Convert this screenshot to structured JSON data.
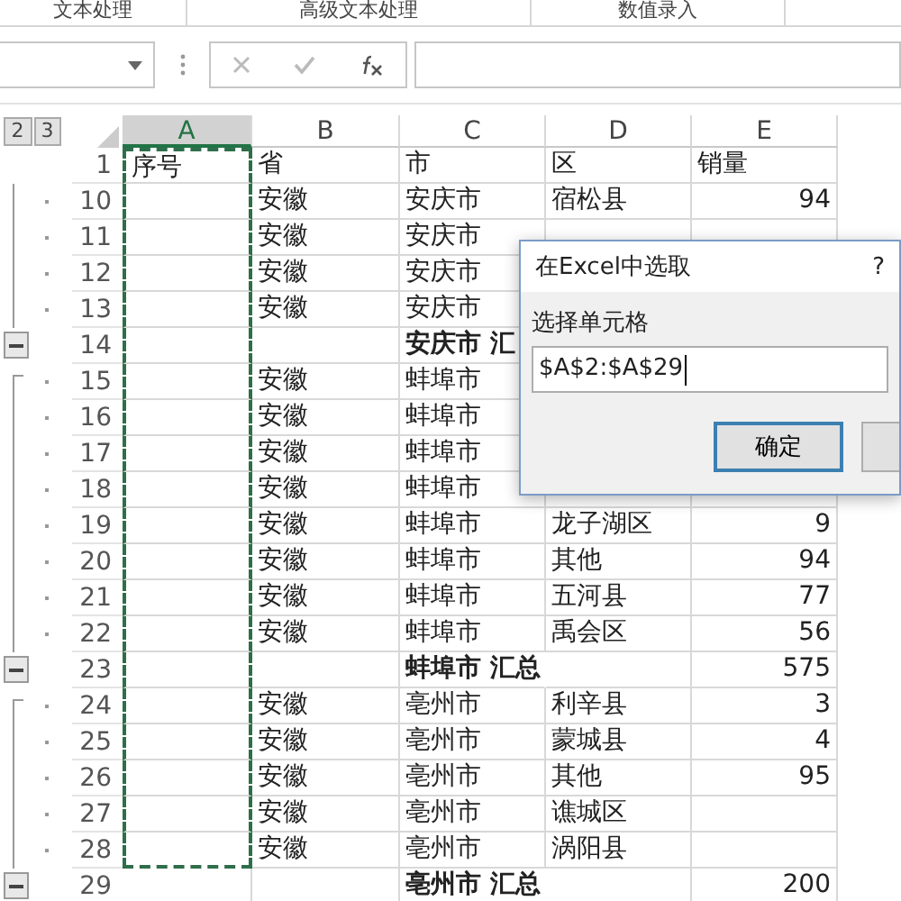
{
  "ribbon_groups": [
    "文本处理",
    "高级文本处理",
    "数值录入"
  ],
  "outline_levels": [
    "2",
    "3"
  ],
  "columns": [
    {
      "label": "A",
      "selected": true
    },
    {
      "label": "B",
      "selected": false
    },
    {
      "label": "C",
      "selected": false
    },
    {
      "label": "D",
      "selected": false
    },
    {
      "label": "E",
      "selected": false
    }
  ],
  "rows": [
    {
      "number": "1",
      "kind": "header",
      "marked": true,
      "A": "序号",
      "B": "省",
      "C": "市",
      "D": "区",
      "E": "销量"
    },
    {
      "number": "10",
      "kind": "detail",
      "marked": true,
      "B": "安徽",
      "C": "安庆市",
      "D": "宿松县",
      "E": "94"
    },
    {
      "number": "11",
      "kind": "detail",
      "marked": true,
      "B": "安徽",
      "C": "安庆市"
    },
    {
      "number": "12",
      "kind": "detail",
      "marked": true,
      "B": "安徽",
      "C": "安庆市"
    },
    {
      "number": "13",
      "kind": "detail",
      "marked": true,
      "B": "安徽",
      "C": "安庆市"
    },
    {
      "number": "14",
      "kind": "subtotal",
      "marked": true,
      "C": "安庆市 汇"
    },
    {
      "number": "15",
      "kind": "detail",
      "marked": true,
      "B": "安徽",
      "C": "蚌埠市"
    },
    {
      "number": "16",
      "kind": "detail",
      "marked": true,
      "B": "安徽",
      "C": "蚌埠市"
    },
    {
      "number": "17",
      "kind": "detail",
      "marked": true,
      "B": "安徽",
      "C": "蚌埠市"
    },
    {
      "number": "18",
      "kind": "detail",
      "marked": true,
      "B": "安徽",
      "C": "蚌埠市"
    },
    {
      "number": "19",
      "kind": "detail",
      "marked": true,
      "B": "安徽",
      "C": "蚌埠市",
      "D": "龙子湖区",
      "E": "9"
    },
    {
      "number": "20",
      "kind": "detail",
      "marked": true,
      "B": "安徽",
      "C": "蚌埠市",
      "D": "其他",
      "E": "94"
    },
    {
      "number": "21",
      "kind": "detail",
      "marked": true,
      "B": "安徽",
      "C": "蚌埠市",
      "D": "五河县",
      "E": "77"
    },
    {
      "number": "22",
      "kind": "detail",
      "marked": true,
      "B": "安徽",
      "C": "蚌埠市",
      "D": "禹会区",
      "E": "56"
    },
    {
      "number": "23",
      "kind": "subtotal",
      "marked": true,
      "C": "蚌埠市 汇总",
      "E": "575"
    },
    {
      "number": "24",
      "kind": "detail",
      "marked": true,
      "B": "安徽",
      "C": "亳州市",
      "D": "利辛县",
      "E": "3"
    },
    {
      "number": "25",
      "kind": "detail",
      "marked": true,
      "B": "安徽",
      "C": "亳州市",
      "D": "蒙城县",
      "E": "4"
    },
    {
      "number": "26",
      "kind": "detail",
      "marked": true,
      "B": "安徽",
      "C": "亳州市",
      "D": "其他",
      "E": "95"
    },
    {
      "number": "27",
      "kind": "detail",
      "marked": true,
      "B": "安徽",
      "C": "亳州市",
      "D": "谯城区"
    },
    {
      "number": "28",
      "kind": "detail",
      "marked": true,
      "B": "安徽",
      "C": "亳州市",
      "D": "涡阳县"
    },
    {
      "number": "29",
      "kind": "subtotal",
      "marked": false,
      "C": "亳州市 汇总",
      "E": "200"
    }
  ],
  "dialog": {
    "title": "在Excel中选取",
    "help": "?",
    "label": "选择单元格",
    "value": "$A$2:$A$29",
    "ok_button": "确定"
  }
}
